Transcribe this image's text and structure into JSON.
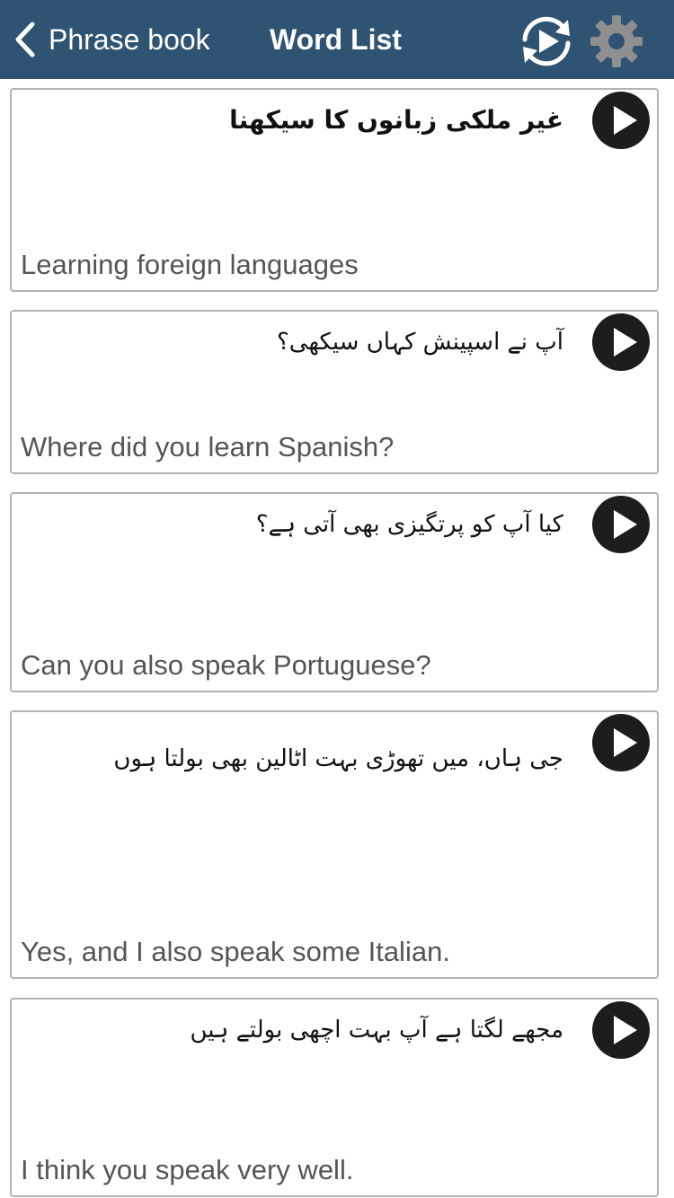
{
  "navbar": {
    "back_label": "Phrase book",
    "title": "Word List",
    "back_icon": "chevron-left-icon",
    "autoplay_icon": "autoplay-repeat-icon",
    "settings_icon": "gear-icon",
    "background_color": "#2f5373"
  },
  "phrases": [
    {
      "urdu": "غیر ملکی زبانوں کا سیکھنا",
      "english": "Learning foreign languages",
      "play_icon": "play-icon"
    },
    {
      "urdu": "آپ نے اسپینش کہاں سیکھی؟",
      "english": "Where did you learn Spanish?",
      "play_icon": "play-icon"
    },
    {
      "urdu": "کیا آپ کو پرتگیزی بھی آتی ہے؟",
      "english": "Can you also speak Portuguese?",
      "play_icon": "play-icon"
    },
    {
      "urdu": "جی ہاں، میں تھوڑی بہت اٹالین بھی بولتا ہوں",
      "english": "Yes, and I also speak some Italian.",
      "play_icon": "play-icon"
    },
    {
      "urdu": "مجھے لگتا ہے آپ بہت اچھی بولتے ہیں",
      "english": "I think you speak very well.",
      "play_icon": "play-icon"
    }
  ]
}
